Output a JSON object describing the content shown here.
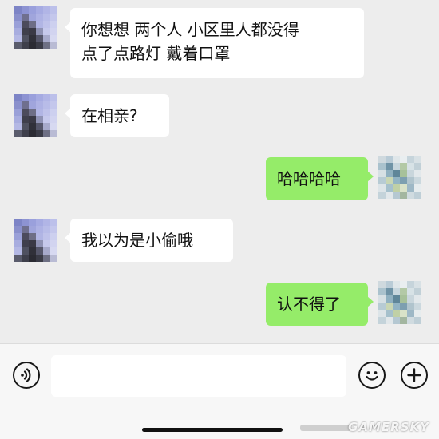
{
  "colors": {
    "background": "#ededed",
    "incoming_bubble": "#ffffff",
    "outgoing_bubble": "#95ec69",
    "input_bar": "#f7f7f7"
  },
  "messages": [
    {
      "side": "incoming",
      "text": "你想想 两个人 小区里人都没得\n点了点路灯 戴着口罩"
    },
    {
      "side": "incoming",
      "text": "在相亲?"
    },
    {
      "side": "outgoing",
      "text": "哈哈哈哈"
    },
    {
      "side": "incoming",
      "text": "我以为是小偷哦"
    },
    {
      "side": "outgoing",
      "text": "认不得了"
    }
  ],
  "input_bar": {
    "voice_icon": "voice-icon",
    "emoji_icon": "emoji-icon",
    "add_icon": "plus-icon",
    "input_value": ""
  },
  "watermark": {
    "text": "GAMERSKY"
  }
}
